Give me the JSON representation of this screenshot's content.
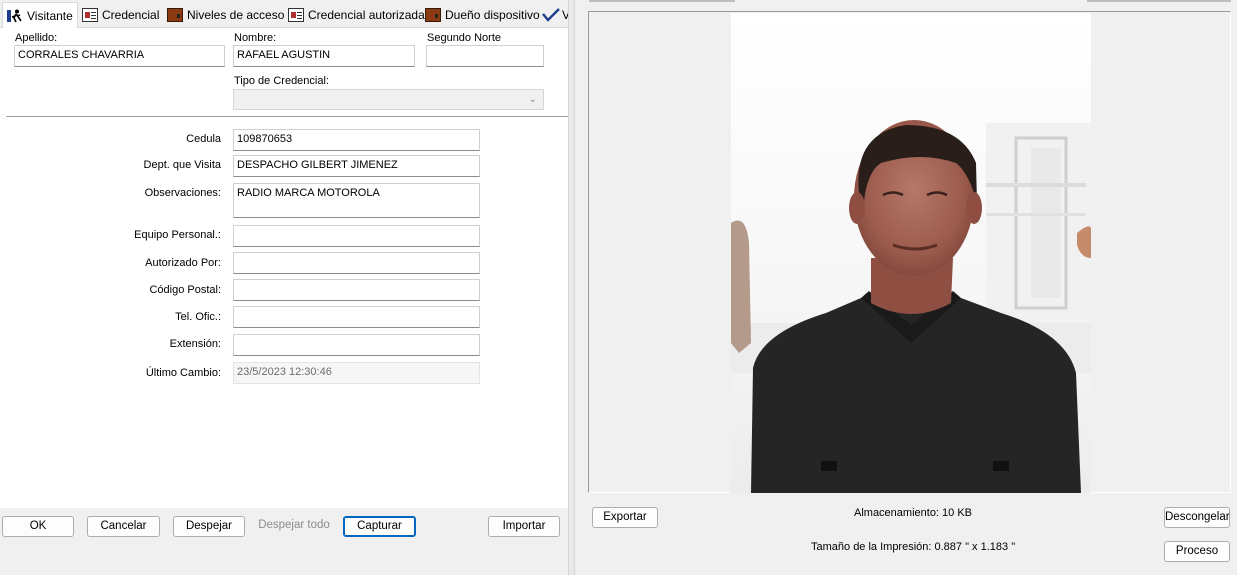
{
  "tabs": [
    {
      "label": "Visitante",
      "icon": "person-walking-icon"
    },
    {
      "label": "Credencial",
      "icon": "id-card-icon"
    },
    {
      "label": "Niveles de acceso",
      "icon": "door-icon"
    },
    {
      "label": "Credencial autorizada",
      "icon": "id-card-icon"
    },
    {
      "label": "Dueño dispositivo",
      "icon": "door-icon"
    },
    {
      "label": "V",
      "icon": "checkmark-icon"
    }
  ],
  "form": {
    "apellido": {
      "label": "Apellido:",
      "value": "CORRALES CHAVARRIA"
    },
    "nombre": {
      "label": "Nombre:",
      "value": "RAFAEL AGUSTIN"
    },
    "segundo": {
      "label": "Segundo Norte",
      "value": ""
    },
    "tipo": {
      "label": "Tipo de Credencial:",
      "value": ""
    },
    "cedula": {
      "label": "Cedula",
      "value": "109870653"
    },
    "dept": {
      "label": "Dept. que Visita",
      "value": "DESPACHO GILBERT JIMENEZ"
    },
    "observaciones": {
      "label": "Observaciones:",
      "value": "RADIO MARCA MOTOROLA"
    },
    "equipo": {
      "label": "Equipo Personal.:",
      "value": ""
    },
    "autorizado": {
      "label": "Autorizado Por:",
      "value": ""
    },
    "postal": {
      "label": "Código Postal:",
      "value": ""
    },
    "tel": {
      "label": "Tel. Ofic.:",
      "value": ""
    },
    "extension": {
      "label": "Extensión:",
      "value": ""
    },
    "ultimo": {
      "label": "Último Cambio:",
      "value": "23/5/2023 12:30:46"
    }
  },
  "buttons": {
    "ok": "OK",
    "cancelar": "Cancelar",
    "despejar": "Despejar",
    "despejar_todo": "Despejar todo",
    "capturar": "Capturar",
    "importar": "Importar",
    "exportar": "Exportar",
    "descongelar": "Descongelar",
    "proceso": "Proceso"
  },
  "image_info": {
    "almacenamiento": "Almacenamiento: 10 KB",
    "tamano": "Tamaño de la Impresión: 0.887 \" x 1.183 \""
  }
}
